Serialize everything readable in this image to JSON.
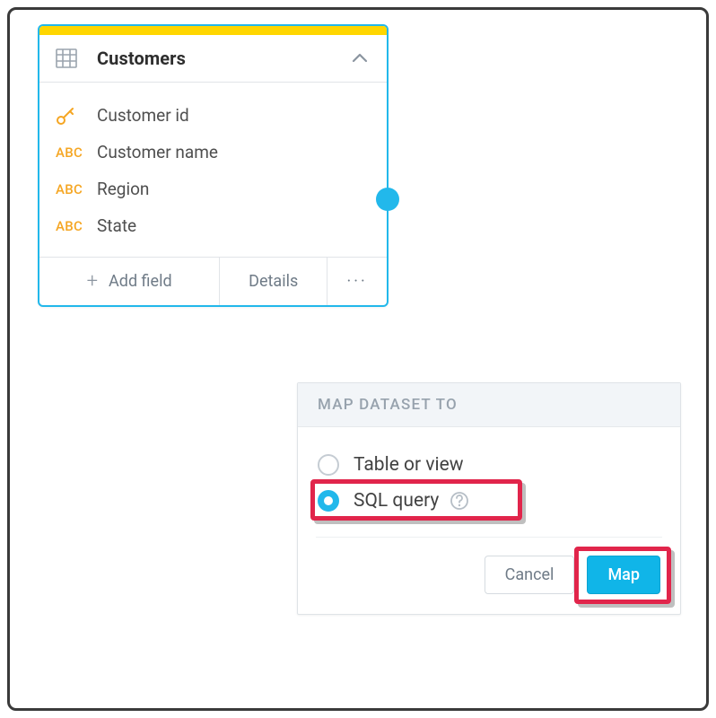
{
  "card": {
    "title": "Customers",
    "fields": [
      {
        "type": "key",
        "label": "Customer id"
      },
      {
        "type": "ABC",
        "label": "Customer name"
      },
      {
        "type": "ABC",
        "label": "Region"
      },
      {
        "type": "ABC",
        "label": "State"
      }
    ],
    "footer": {
      "add": "Add field",
      "details": "Details",
      "more": "···"
    }
  },
  "dialog": {
    "header": "MAP DATASET TO",
    "options": {
      "table": "Table or view",
      "sql": "SQL query"
    },
    "buttons": {
      "cancel": "Cancel",
      "map": "Map"
    }
  }
}
